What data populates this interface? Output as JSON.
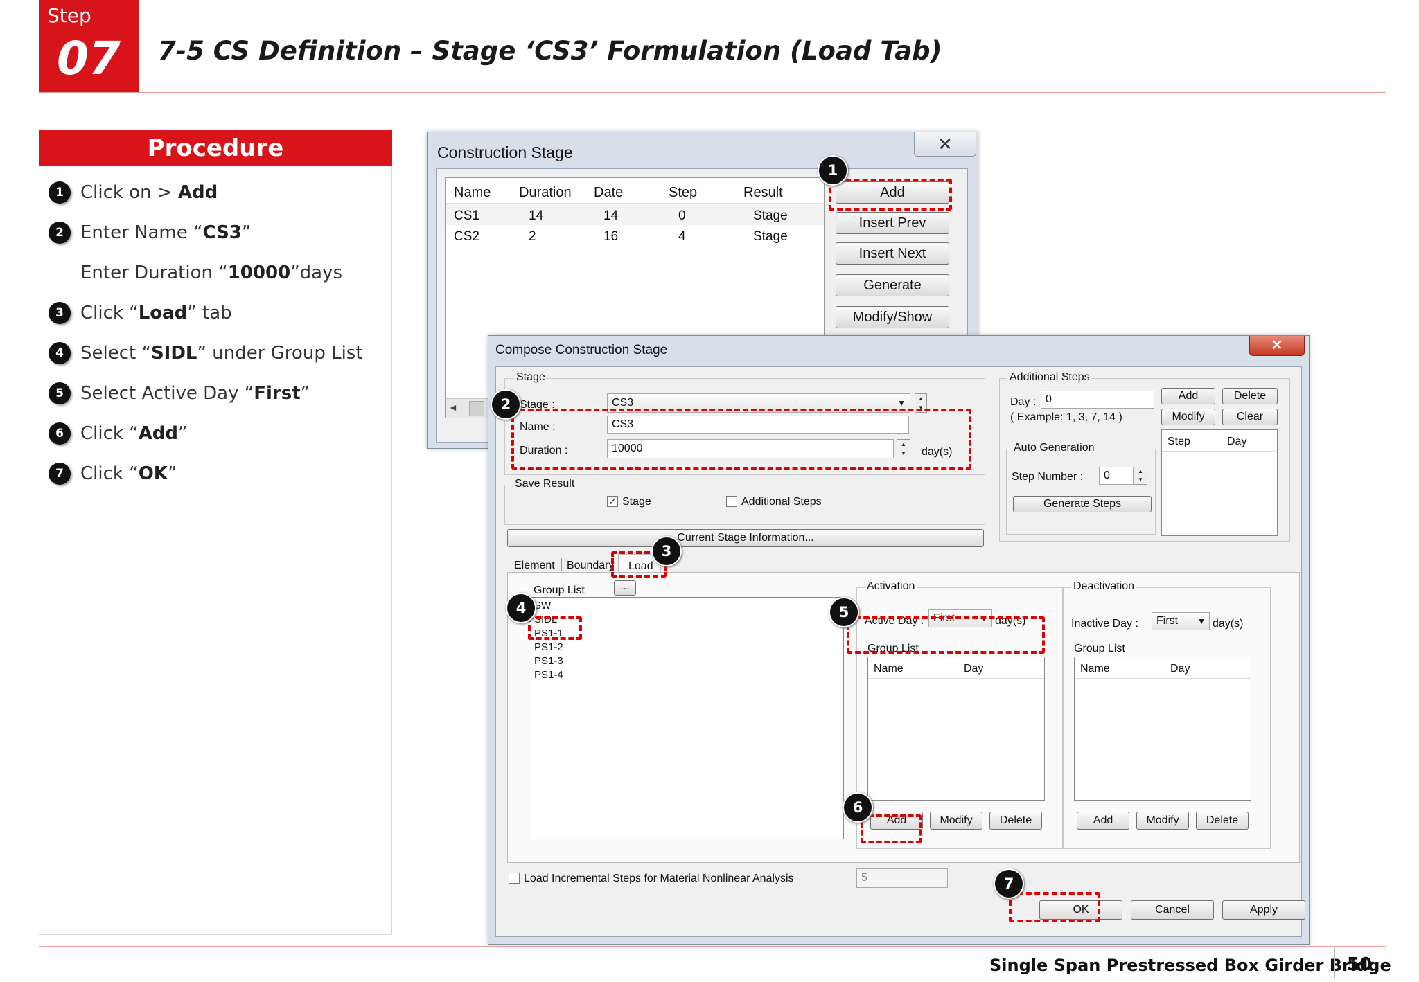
{
  "header": {
    "step_word": "Step",
    "step_number": "07",
    "title": "7-5 CS Definition – Stage ‘CS3’ Formulation (Load Tab)"
  },
  "procedure": {
    "heading": "Procedure",
    "items": [
      {
        "n": "1",
        "pre": "Click on > ",
        "bold": "Add",
        "post": ""
      },
      {
        "n": "2",
        "pre": "Enter Name “",
        "bold": "CS3",
        "post": "”"
      },
      {
        "n": "",
        "pre": "Enter Duration “",
        "bold": "10000",
        "post": "”days"
      },
      {
        "n": "3",
        "pre": "Click “",
        "bold": "Load",
        "post": "” tab"
      },
      {
        "n": "4",
        "pre": "Select “",
        "bold": "SIDL",
        "post": "” under Group List"
      },
      {
        "n": "5",
        "pre": "Select Active Day “",
        "bold": "First",
        "post": "”"
      },
      {
        "n": "6",
        "pre": "Click “",
        "bold": "Add",
        "post": "”"
      },
      {
        "n": "7",
        "pre": "Click “",
        "bold": "OK",
        "post": "”"
      }
    ]
  },
  "cs_window": {
    "title": "Construction Stage",
    "close_glyph": "✕",
    "columns": [
      "Name",
      "Duration",
      "Date",
      "Step",
      "Result"
    ],
    "rows": [
      [
        "CS1",
        "14",
        "14",
        "0",
        "Stage"
      ],
      [
        "CS2",
        "2",
        "16",
        "4",
        "Stage"
      ]
    ],
    "buttons": [
      "Add",
      "Insert Prev",
      "Insert Next",
      "Generate",
      "Modify/Show"
    ],
    "scroll_left_glyph": "◄"
  },
  "compose": {
    "title": "Compose Construction Stage",
    "close_glyph": "✕",
    "stage_group": "Stage",
    "stage_label": "Stage :",
    "stage_value": "CS3",
    "name_label": "Name :",
    "name_value": "CS3",
    "duration_label": "Duration :",
    "duration_value": "10000",
    "duration_unit": "day(s)",
    "save_result": "Save Result",
    "save_stage": "Stage",
    "save_additional": "Additional Steps",
    "current_stage_btn": "Current Stage Information...",
    "additional": {
      "title": "Additional Steps",
      "day_label": "Day :",
      "day_value": "0",
      "example": "( Example: 1, 3, 7, 14  )",
      "add": "Add",
      "delete": "Delete",
      "modify": "Modify",
      "clear": "Clear",
      "col_step": "Step",
      "col_day": "Day",
      "auto_gen": "Auto Generation",
      "step_number_label": "Step Number  :",
      "step_number_value": "0",
      "generate_steps": "Generate Steps"
    },
    "tabs": [
      "Element",
      "Boundary",
      "Load"
    ],
    "group_list_label": "Group List",
    "group_list_btn": "...",
    "group_items": [
      "SW",
      "SIDL",
      "PS1-1",
      "PS1-2",
      "PS1-3",
      "PS1-4"
    ],
    "activation": {
      "title": "Activation",
      "active_day_label": "Active Day :",
      "active_day_value": "First",
      "unit": "day(s)",
      "group_list": "Group List",
      "col_name": "Name",
      "col_day": "Day",
      "add": "Add",
      "modify": "Modify",
      "delete": "Delete"
    },
    "deactivation": {
      "title": "Deactivation",
      "inactive_day_label": "Inactive Day :",
      "inactive_day_value": "First",
      "unit": "day(s)",
      "group_list": "Group List",
      "col_name": "Name",
      "col_day": "Day",
      "add": "Add",
      "modify": "Modify",
      "delete": "Delete"
    },
    "load_incremental": "Load Incremental Steps for Material Nonlinear Analysis",
    "load_incremental_value": "5",
    "ok": "OK",
    "cancel": "Cancel",
    "apply": "Apply"
  },
  "callouts": [
    "1",
    "2",
    "3",
    "4",
    "5",
    "6",
    "7"
  ],
  "footer": {
    "text": "Single Span Prestressed Box Girder Bridge",
    "page": "50"
  },
  "colors": {
    "brand_red": "#d7141a",
    "highlight_red": "#e00000"
  }
}
